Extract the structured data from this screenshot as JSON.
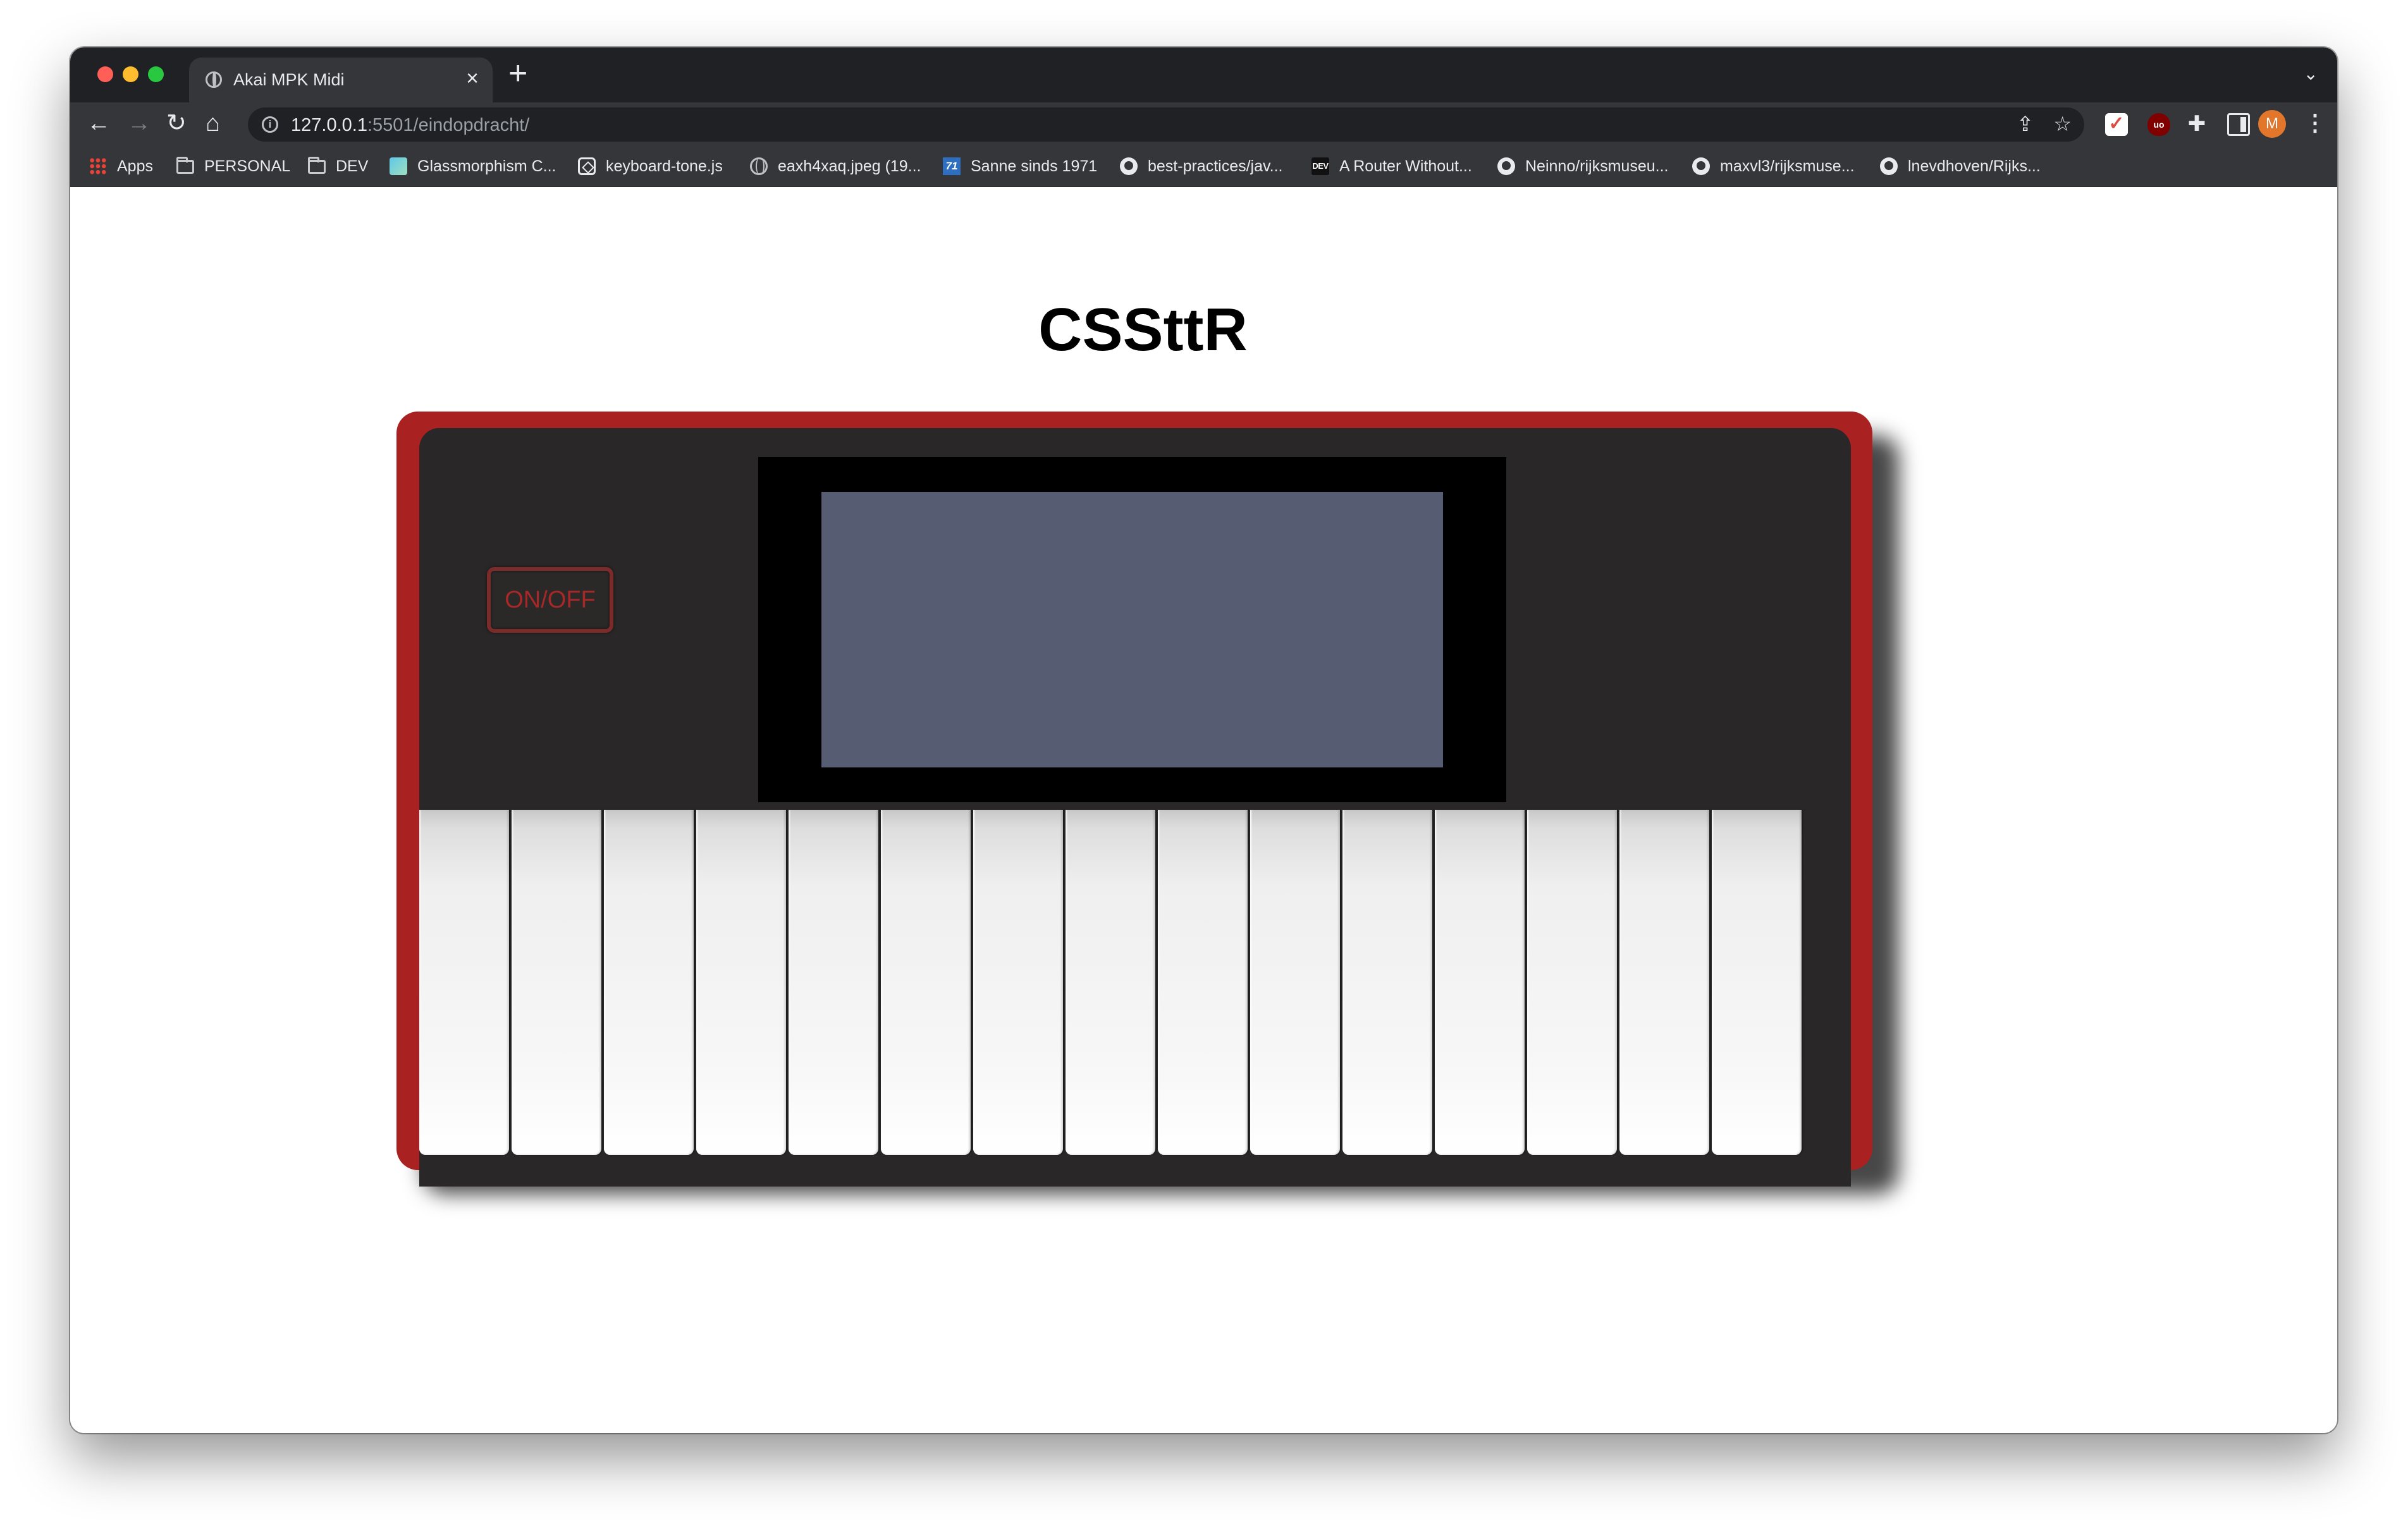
{
  "browser": {
    "tab_title": "Akai MPK Midi",
    "tab_close": "×",
    "new_tab": "+",
    "tab_menu": "⌄",
    "url_host": "127.0.0.1",
    "url_path": ":5501/eindopdracht/",
    "avatar_initial": "M",
    "bookmarks": [
      {
        "label": "Apps",
        "icon": "apps-grid-icon"
      },
      {
        "label": "PERSONAL",
        "icon": "folder-icon"
      },
      {
        "label": "DEV",
        "icon": "folder-icon"
      },
      {
        "label": "Glassmorphism C...",
        "icon": "glassmorphism-favicon"
      },
      {
        "label": "keyboard-tone.js",
        "icon": "codesandbox-icon"
      },
      {
        "label": "eaxh4xaq.jpeg (19...",
        "icon": "globe-icon"
      },
      {
        "label": "Sanne sinds 1971",
        "icon": "71-favicon"
      },
      {
        "label": "best-practices/jav...",
        "icon": "github-icon"
      },
      {
        "label": "A Router Without...",
        "icon": "dev-favicon"
      },
      {
        "label": "Neinno/rijksmuseu...",
        "icon": "github-icon"
      },
      {
        "label": "maxvl3/rijksmuse...",
        "icon": "github-icon"
      },
      {
        "label": "lnevdhoven/Rijks...",
        "icon": "github-icon"
      }
    ]
  },
  "page": {
    "title": "CSSttR",
    "power_button": "ON/OFF",
    "key_count": 15
  },
  "colors": {
    "chassis": "#aa2121",
    "panel": "#292727",
    "display_bezel": "#000000",
    "display_screen": "#565c71",
    "power_text": "#a72828"
  }
}
